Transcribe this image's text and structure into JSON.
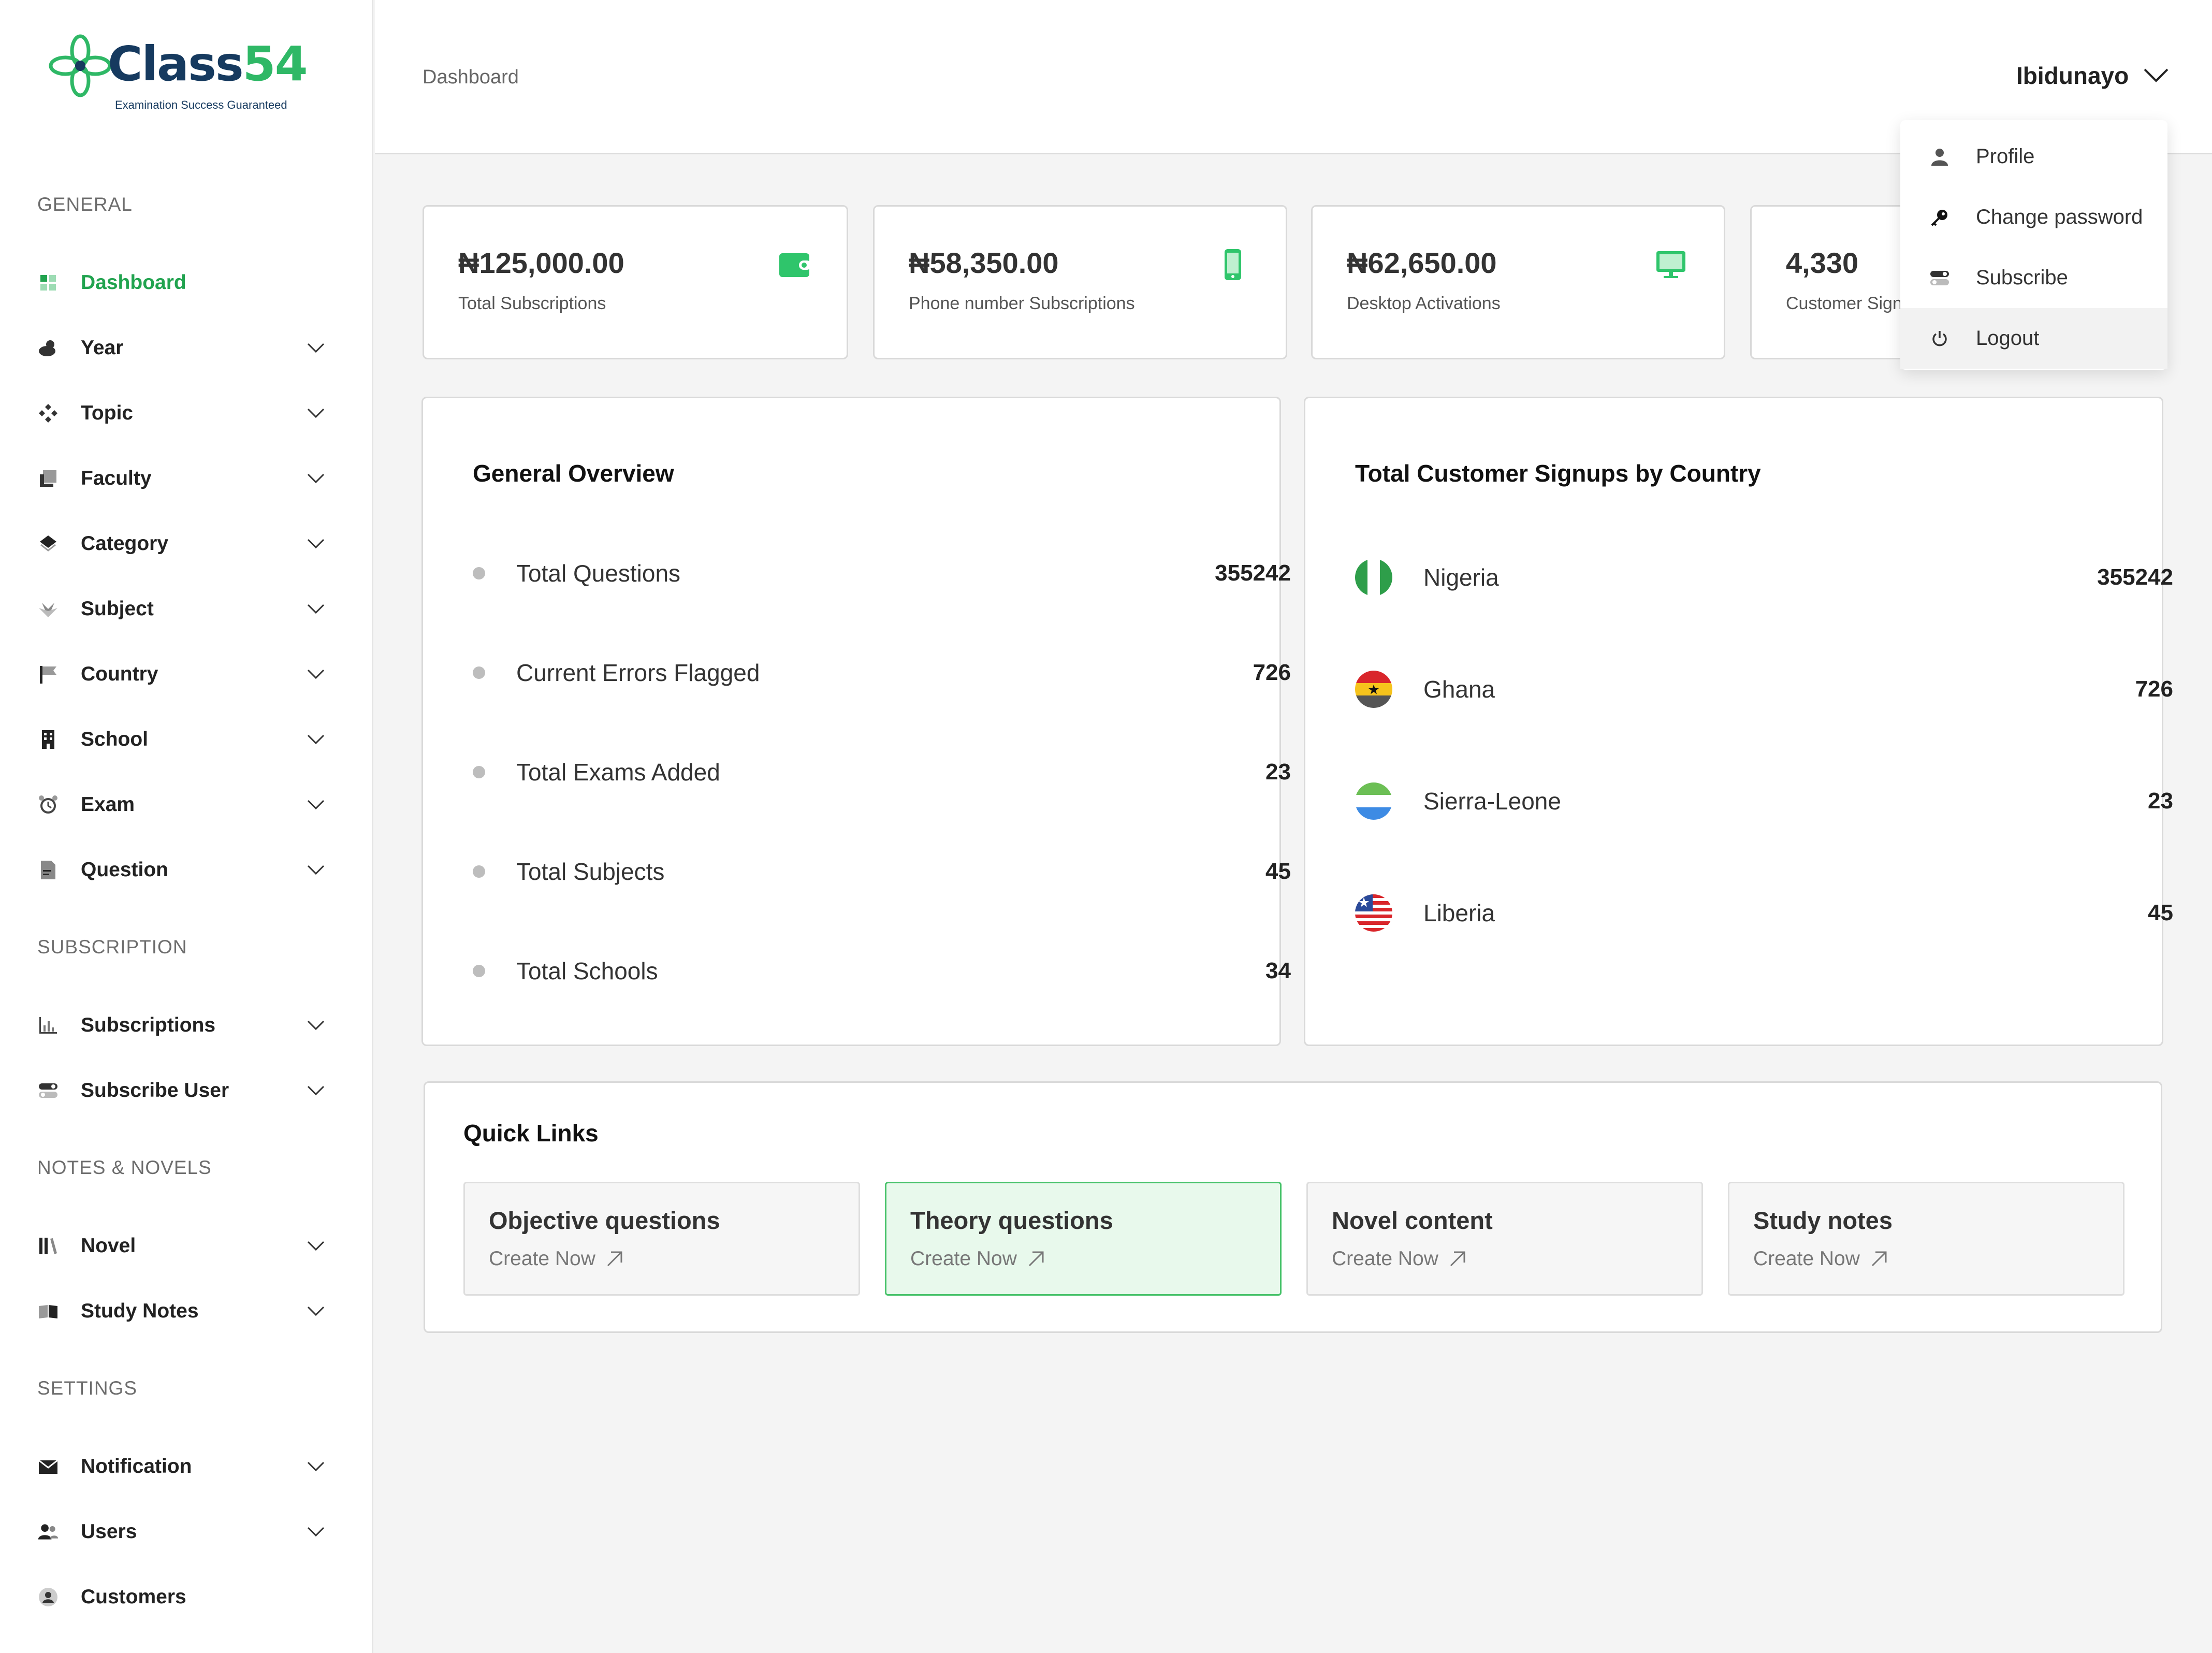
{
  "brand": {
    "name_main": "Class",
    "name_num": "54",
    "tagline": "Examination Success Guaranteed"
  },
  "sidebar": {
    "sections": [
      "GENERAL",
      "SUBSCRIPTION",
      "NOTES & NOVELS",
      "SETTINGS"
    ],
    "items": [
      {
        "label": "Dashboard",
        "icon": "dashboard-icon",
        "active": true
      },
      {
        "label": "Year",
        "icon": "weather-icon"
      },
      {
        "label": "Topic",
        "icon": "topic-icon"
      },
      {
        "label": "Faculty",
        "icon": "faculty-icon"
      },
      {
        "label": "Category",
        "icon": "category-icon"
      },
      {
        "label": "Subject",
        "icon": "subject-icon"
      },
      {
        "label": "Country",
        "icon": "flag-icon"
      },
      {
        "label": "School",
        "icon": "building-icon"
      },
      {
        "label": "Exam",
        "icon": "alarm-icon"
      },
      {
        "label": "Question",
        "icon": "document-icon"
      },
      {
        "label": "Subscriptions",
        "icon": "bar-chart-icon"
      },
      {
        "label": "Subscribe User",
        "icon": "toggle-icon"
      },
      {
        "label": "Novel",
        "icon": "books-icon"
      },
      {
        "label": "Study Notes",
        "icon": "book-open-icon"
      },
      {
        "label": "Notification",
        "icon": "mail-icon"
      },
      {
        "label": "Users",
        "icon": "users-icon"
      },
      {
        "label": "Customers",
        "icon": "customer-icon"
      }
    ]
  },
  "header": {
    "breadcrumb": "Dashboard",
    "user_name": "Ibidunayo"
  },
  "user_menu": [
    {
      "label": "Profile",
      "icon": "person-icon"
    },
    {
      "label": "Change password",
      "icon": "key-icon"
    },
    {
      "label": "Subscribe",
      "icon": "toggle-icon"
    },
    {
      "label": "Logout",
      "icon": "power-icon",
      "highlighted": true
    }
  ],
  "stats": [
    {
      "amount": "₦125,000.00",
      "caption": "Total Subscriptions",
      "icon": "wallet-icon"
    },
    {
      "amount": "₦58,350.00",
      "caption": "Phone number Subscriptions",
      "icon": "phone-icon"
    },
    {
      "amount": "₦62,650.00",
      "caption": "Desktop Activations",
      "icon": "desktop-icon"
    },
    {
      "amount": "4,330",
      "caption": "Customer Signups",
      "icon": "users-icon"
    }
  ],
  "overview": {
    "title": "General Overview",
    "rows": [
      {
        "label": "Total Questions",
        "value": "355242"
      },
      {
        "label": "Current Errors Flagged",
        "value": "726"
      },
      {
        "label": "Total Exams Added",
        "value": "23"
      },
      {
        "label": "Total Subjects",
        "value": "45"
      },
      {
        "label": "Total Schools",
        "value": "34"
      }
    ]
  },
  "signups": {
    "title": "Total Customer Signups by Country",
    "rows": [
      {
        "country": "Nigeria",
        "value": "355242"
      },
      {
        "country": "Ghana",
        "value": "726"
      },
      {
        "country": "Sierra-Leone",
        "value": "23"
      },
      {
        "country": "Liberia",
        "value": "45"
      }
    ]
  },
  "quick_links": {
    "title": "Quick Links",
    "items": [
      {
        "title": "Objective questions",
        "sub": "Create Now"
      },
      {
        "title": "Theory questions",
        "sub": "Create Now",
        "active": true
      },
      {
        "title": "Novel content",
        "sub": "Create Now"
      },
      {
        "title": "Study notes",
        "sub": "Create Now"
      }
    ]
  },
  "colors": {
    "brand_green": "#21a34f",
    "brand_navy": "#163a5f",
    "accent_bg": "#e8f9ec"
  }
}
